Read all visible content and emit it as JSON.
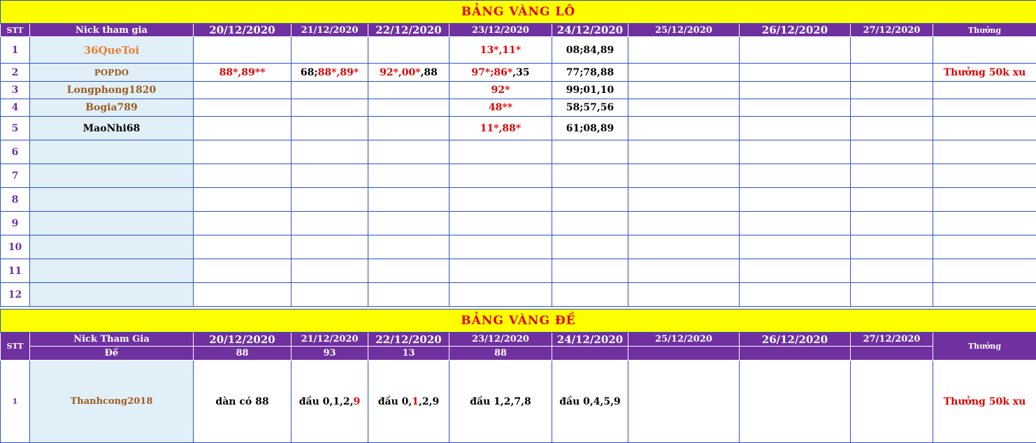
{
  "lo": {
    "title": "BẢNG VÀNG LÔ",
    "headers": {
      "stt": "STT",
      "nick": "Nick tham gia",
      "dates": [
        "20/12/2020",
        "21/12/2020",
        "22/12/2020",
        "23/12/2020",
        "24/12/2020",
        "25/12/2020",
        "26/12/2020",
        "27/12/2020"
      ],
      "reward": "Thưởng"
    },
    "rows": [
      {
        "stt": "1",
        "nick": "36QueToi",
        "nick_color": "#ed7d31",
        "cells": [
          [],
          [],
          [],
          [
            [
              "13*,11*",
              "r"
            ]
          ],
          [
            [
              "08;84,89",
              "b"
            ]
          ],
          [],
          [],
          []
        ],
        "reward": ""
      },
      {
        "stt": "2",
        "nick": "POPDO",
        "nick_color": "#9c5a1c",
        "cells": [
          [
            [
              "88*,89**",
              "r"
            ]
          ],
          [
            [
              "68;",
              "b"
            ],
            [
              "88*,89*",
              "r"
            ]
          ],
          [
            [
              "92*,00*",
              "r"
            ],
            [
              ",88",
              "b"
            ]
          ],
          [
            [
              "97*;86*",
              "r"
            ],
            [
              ",35",
              "b"
            ]
          ],
          [
            [
              "77;78,88",
              "b"
            ]
          ],
          [],
          [],
          []
        ],
        "reward": "Thưởng 50k xu"
      },
      {
        "stt": "3",
        "nick": "Longphong1820",
        "nick_color": "#9c5a1c",
        "cells": [
          [],
          [],
          [],
          [
            [
              "92*",
              "r"
            ]
          ],
          [
            [
              "99;01,10",
              "b"
            ]
          ],
          [],
          [],
          []
        ],
        "reward": ""
      },
      {
        "stt": "4",
        "nick": "Bogia789",
        "nick_color": "#9c5a1c",
        "cells": [
          [],
          [],
          [],
          [
            [
              "48**",
              "r"
            ]
          ],
          [
            [
              "58;57,56",
              "b"
            ]
          ],
          [],
          [],
          []
        ],
        "reward": ""
      },
      {
        "stt": "5",
        "nick": "MaoNhi68",
        "nick_color": "#000000",
        "cells": [
          [],
          [],
          [],
          [
            [
              "11*,88*",
              "r"
            ]
          ],
          [
            [
              "61;08,89",
              "b"
            ]
          ],
          [],
          [],
          []
        ],
        "reward": ""
      },
      {
        "stt": "6",
        "nick": "",
        "nick_color": "#000000",
        "cells": [
          [],
          [],
          [],
          [],
          [],
          [],
          [],
          []
        ],
        "reward": ""
      },
      {
        "stt": "7",
        "nick": "",
        "nick_color": "#000000",
        "cells": [
          [],
          [],
          [],
          [],
          [],
          [],
          [],
          []
        ],
        "reward": ""
      },
      {
        "stt": "8",
        "nick": "",
        "nick_color": "#000000",
        "cells": [
          [],
          [],
          [],
          [],
          [],
          [],
          [],
          []
        ],
        "reward": ""
      },
      {
        "stt": "9",
        "nick": "",
        "nick_color": "#000000",
        "cells": [
          [],
          [],
          [],
          [],
          [],
          [],
          [],
          []
        ],
        "reward": ""
      },
      {
        "stt": "10",
        "nick": "",
        "nick_color": "#000000",
        "cells": [
          [],
          [],
          [],
          [],
          [],
          [],
          [],
          []
        ],
        "reward": ""
      },
      {
        "stt": "11",
        "nick": "",
        "nick_color": "#000000",
        "cells": [
          [],
          [],
          [],
          [],
          [],
          [],
          [],
          []
        ],
        "reward": ""
      },
      {
        "stt": "12",
        "nick": "",
        "nick_color": "#000000",
        "cells": [
          [],
          [],
          [],
          [],
          [],
          [],
          [],
          []
        ],
        "reward": ""
      }
    ]
  },
  "de": {
    "title": "BẢNG VÀNG ĐỀ",
    "headers": {
      "stt": "STT",
      "nick": "Nick Tham Gia",
      "de_label": "Đề",
      "dates": [
        "20/12/2020",
        "21/12/2020",
        "22/12/2020",
        "23/12/2020",
        "24/12/2020",
        "25/12/2020",
        "26/12/2020",
        "27/12/2020"
      ],
      "results": [
        "88",
        "93",
        "13",
        "88",
        "",
        "",
        "",
        ""
      ],
      "reward": "Thưởng"
    },
    "rows": [
      {
        "stt": "1",
        "nick": "Thanhcong2018",
        "nick_color": "#9c5a1c",
        "cells": [
          [
            [
              "dàn có 88",
              "b"
            ]
          ],
          [
            [
              "đầu 0,1,2,",
              "b"
            ],
            [
              "9",
              "r"
            ]
          ],
          [
            [
              "đầu 0,",
              "b"
            ],
            [
              "1",
              "r"
            ],
            [
              ",2,9",
              "b"
            ]
          ],
          [
            [
              "đầu 1,2,7,8",
              "b"
            ]
          ],
          [
            [
              "đầu 0,4,5,9",
              "b"
            ]
          ],
          [],
          [],
          []
        ],
        "reward": "Thưởng 50k xu"
      }
    ]
  },
  "colors": {
    "banner_bg": "#ffff00",
    "banner_text": "#e00000",
    "header_bg": "#7030a0",
    "nick_bg": "#e1f0f8",
    "grid": "#2a53c9",
    "accent_red": "#e00000"
  }
}
